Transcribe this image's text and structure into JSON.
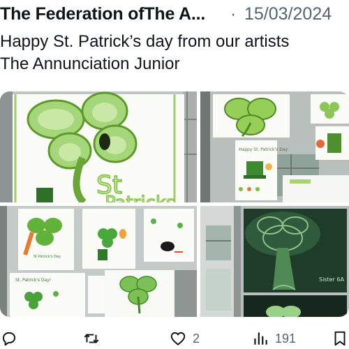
{
  "tweet": {
    "author": "The Federation ofThe A...",
    "separator": "·",
    "date": "15/03/2024",
    "text_lines": [
      "Happy St. Patrick’s day from our artists",
      "The Annunciation Junior"
    ]
  },
  "media": {
    "images": [
      {
        "icon": "shamrock-poster-photo",
        "labels": [
          "St",
          "Patricks"
        ]
      },
      {
        "icon": "shamrock-artwork-wall-photo",
        "labels": [
          "Happy St. Patrick's Day"
        ]
      },
      {
        "icon": "shamrock-drawings-photo",
        "labels": [
          "St Patrick's Day",
          "St. Patrick's Day!"
        ]
      },
      {
        "icon": "celtic-tree-artwork-photo",
        "labels": [
          "Sister 6A"
        ]
      }
    ]
  },
  "actions": {
    "reply": {
      "icon": "reply-icon",
      "count": ""
    },
    "retweet": {
      "icon": "retweet-icon",
      "count": ""
    },
    "like": {
      "icon": "heart-icon",
      "count": "2"
    },
    "views": {
      "icon": "views-icon",
      "count": "191"
    },
    "bookmark": {
      "icon": "bookmark-icon",
      "count": ""
    }
  },
  "colors": {
    "text": "#0f1419",
    "muted": "#536471",
    "shamrock_green": "#7bbf3a",
    "dark_green": "#1f3b2a"
  }
}
